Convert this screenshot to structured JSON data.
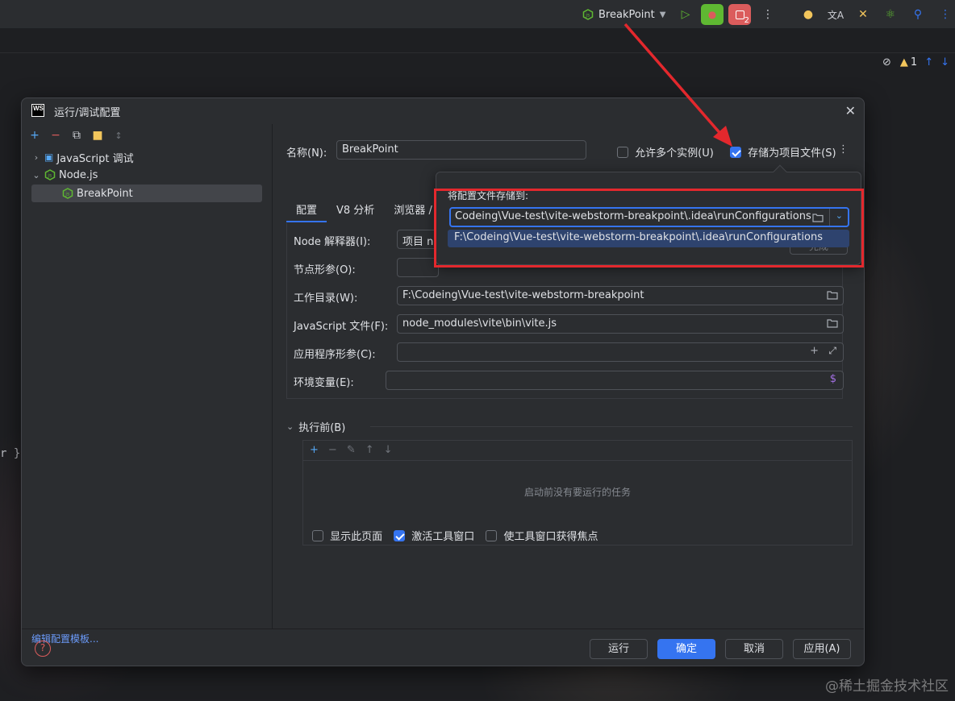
{
  "toolbar": {
    "run_config_name": "BreakPoint",
    "debug_badge": "2",
    "inspection_count": "1"
  },
  "editor": {
    "code_fragment": "r }"
  },
  "dialog": {
    "title": "运行/调试配置",
    "tree": {
      "group_js_debug": "JavaScript 调试",
      "group_node": "Node.js",
      "item_breakpoint": "BreakPoint"
    },
    "edit_templates_link": "编辑配置模板...",
    "name_label": "名称(N):",
    "name_value": "BreakPoint",
    "allow_multiple_label": "允许多个实例(U)",
    "store_as_project_label": "存储为项目文件(S)",
    "tabs": [
      "配置",
      "V8 分析",
      "浏览器 /"
    ],
    "fields": {
      "node_interpreter_label": "Node 解释器(I):",
      "node_interpreter_value": "项目  n",
      "node_params_label": "节点形参(O):",
      "node_params_value": "",
      "working_dir_label": "工作目录(W):",
      "working_dir_value": "F:\\Codeing\\Vue-test\\vite-webstorm-breakpoint",
      "js_file_label": "JavaScript 文件(F):",
      "js_file_value": "node_modules\\vite\\bin\\vite.js",
      "app_params_label": "应用程序形参(C):",
      "app_params_value": "",
      "env_label": "环境变量(E):",
      "env_value": ""
    },
    "before_launch": {
      "header": "执行前(B)",
      "empty_text": "启动前没有要运行的任务"
    },
    "options": {
      "show_page": "显示此页面",
      "activate_tool_window": "激活工具窗口",
      "focus_tool_window": "使工具窗口获得焦点"
    },
    "buttons": {
      "run": "运行",
      "ok": "确定",
      "cancel": "取消",
      "apply": "应用(A)"
    }
  },
  "popup": {
    "title": "将配置文件存储到:",
    "combo_value": "Codeing\\Vue-test\\vite-webstorm-breakpoint\\.idea\\runConfigurations",
    "dropdown_option": "F:\\Codeing\\Vue-test\\vite-webstorm-breakpoint\\.idea\\runConfigurations",
    "hidden_button": "完成"
  },
  "watermark": "@稀土掘金技术社区",
  "colors": {
    "accent": "#3574f0",
    "annotation_red": "#e3282d",
    "node_green": "#5fb832",
    "link_blue": "#6b9bfa"
  }
}
